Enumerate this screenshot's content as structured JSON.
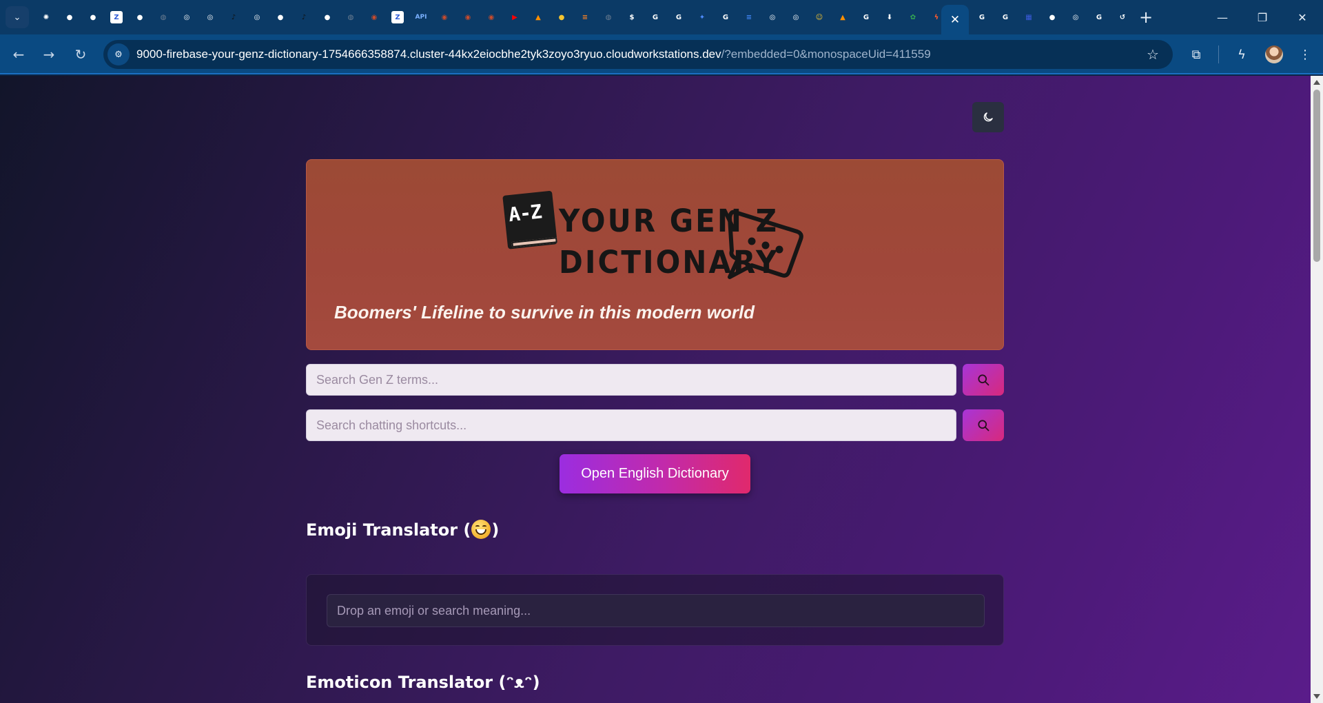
{
  "browser": {
    "tabs_left": [
      {
        "icon": "chatgpt-icon",
        "color": "#ffffff",
        "glyph": "✺"
      },
      {
        "icon": "github-icon",
        "color": "#ffffff",
        "glyph": "●"
      },
      {
        "icon": "github-icon",
        "color": "#ffffff",
        "glyph": "●"
      },
      {
        "icon": "zedge-icon",
        "color": "#2d5bd7",
        "glyph": "Z"
      },
      {
        "icon": "github-icon",
        "color": "#ffffff",
        "glyph": "●"
      },
      {
        "icon": "globe-icon",
        "color": "#6f7f92",
        "glyph": "◍"
      },
      {
        "icon": "chrome-icon",
        "color": "#ffffff",
        "glyph": "◎"
      },
      {
        "icon": "chrome-icon",
        "color": "#ffffff",
        "glyph": "◎"
      },
      {
        "icon": "tiktok-icon",
        "color": "#111111",
        "glyph": "♪"
      },
      {
        "icon": "chrome-icon",
        "color": "#ffffff",
        "glyph": "◎"
      },
      {
        "icon": "github-icon",
        "color": "#ffffff",
        "glyph": "●"
      },
      {
        "icon": "tiktok-icon",
        "color": "#111111",
        "glyph": "♪"
      },
      {
        "icon": "github-icon",
        "color": "#ffffff",
        "glyph": "●"
      },
      {
        "icon": "globe-icon",
        "color": "#6f7f92",
        "glyph": "◍"
      },
      {
        "icon": "replit-icon",
        "color": "#c84b2c",
        "glyph": "◉"
      },
      {
        "icon": "zedge-icon",
        "color": "#2d5bd7",
        "glyph": "Z"
      },
      {
        "icon": "api-icon",
        "color": "#7ab0ff",
        "glyph": "API"
      },
      {
        "icon": "replit-icon",
        "color": "#c84b2c",
        "glyph": "◉"
      },
      {
        "icon": "replit-icon",
        "color": "#c84b2c",
        "glyph": "◉"
      },
      {
        "icon": "replit-icon",
        "color": "#c84b2c",
        "glyph": "◉"
      },
      {
        "icon": "youtube-icon",
        "color": "#ff0000",
        "glyph": "▶"
      },
      {
        "icon": "firebase-icon",
        "color": "#ff8f00",
        "glyph": "▲"
      },
      {
        "icon": "lightbulb-icon",
        "color": "#f4c430",
        "glyph": "●"
      },
      {
        "icon": "stackoverflow-icon",
        "color": "#f48024",
        "glyph": "≡"
      },
      {
        "icon": "globe-icon",
        "color": "#6f7f92",
        "glyph": "◍"
      },
      {
        "icon": "dollar-icon",
        "color": "#ffffff",
        "glyph": "$"
      },
      {
        "icon": "google-icon",
        "color": "#ffffff",
        "glyph": "G"
      },
      {
        "icon": "google-icon",
        "color": "#ffffff",
        "glyph": "G"
      },
      {
        "icon": "gemini-icon",
        "color": "#4f8cff",
        "glyph": "✦"
      },
      {
        "icon": "google-icon",
        "color": "#ffffff",
        "glyph": "G"
      },
      {
        "icon": "docs-icon",
        "color": "#4285f4",
        "glyph": "≡"
      },
      {
        "icon": "chrome-icon",
        "color": "#ffffff",
        "glyph": "◎"
      },
      {
        "icon": "chrome-icon",
        "color": "#ffffff",
        "glyph": "◎"
      },
      {
        "icon": "smile-icon",
        "color": "#f4c430",
        "glyph": "☺"
      },
      {
        "icon": "firebase-icon",
        "color": "#ff8f00",
        "glyph": "▲"
      },
      {
        "icon": "google-icon",
        "color": "#ffffff",
        "glyph": "G"
      },
      {
        "icon": "download-icon",
        "color": "#ffffff",
        "glyph": "⬇"
      },
      {
        "icon": "pinwheel-icon",
        "color": "#34a853",
        "glyph": "✿"
      },
      {
        "icon": "bolt-icon",
        "color": "#ff5a2c",
        "glyph": "ϟ"
      }
    ],
    "tabs_right": [
      {
        "icon": "google-icon",
        "color": "#ffffff",
        "glyph": "G"
      },
      {
        "icon": "google-icon",
        "color": "#ffffff",
        "glyph": "G"
      },
      {
        "icon": "site-icon",
        "color": "#3b5bdb",
        "glyph": "▦"
      },
      {
        "icon": "github-icon",
        "color": "#ffffff",
        "glyph": "●"
      },
      {
        "icon": "chrome-icon",
        "color": "#ffffff",
        "glyph": "◎"
      },
      {
        "icon": "google-icon",
        "color": "#ffffff",
        "glyph": "G"
      },
      {
        "icon": "history-icon",
        "color": "#ffffff",
        "glyph": "↺"
      }
    ],
    "url_host": "9000-firebase-your-genz-dictionary-1754666358874.cluster-44kx2eiocbhe2tyk3zoyo3ryuo.cloudworkstations.dev",
    "url_path": "/?embedded=0&monospaceUid=411559"
  },
  "hero": {
    "logo_line1": "YOUR GEN Z",
    "logo_line2": "DICTIONARY",
    "logo_badge": "A-Z",
    "tagline": "Boomers' Lifeline to survive in this modern world"
  },
  "search": {
    "terms_placeholder": "Search Gen Z terms...",
    "shortcuts_placeholder": "Search chatting shortcuts..."
  },
  "open_dictionary_label": "Open English Dictionary",
  "emoji_section": {
    "title_prefix": "Emoji Translator (",
    "title_suffix": ")",
    "input_placeholder": "Drop an emoji or search meaning..."
  },
  "emoticon_section": {
    "title": "Emoticon Translator (ᵔᴥᵔ)"
  },
  "colors": {
    "accent_gradient_start": "#a735d8",
    "accent_gradient_end": "#e0296c",
    "hero_bg": "#a0473a"
  }
}
